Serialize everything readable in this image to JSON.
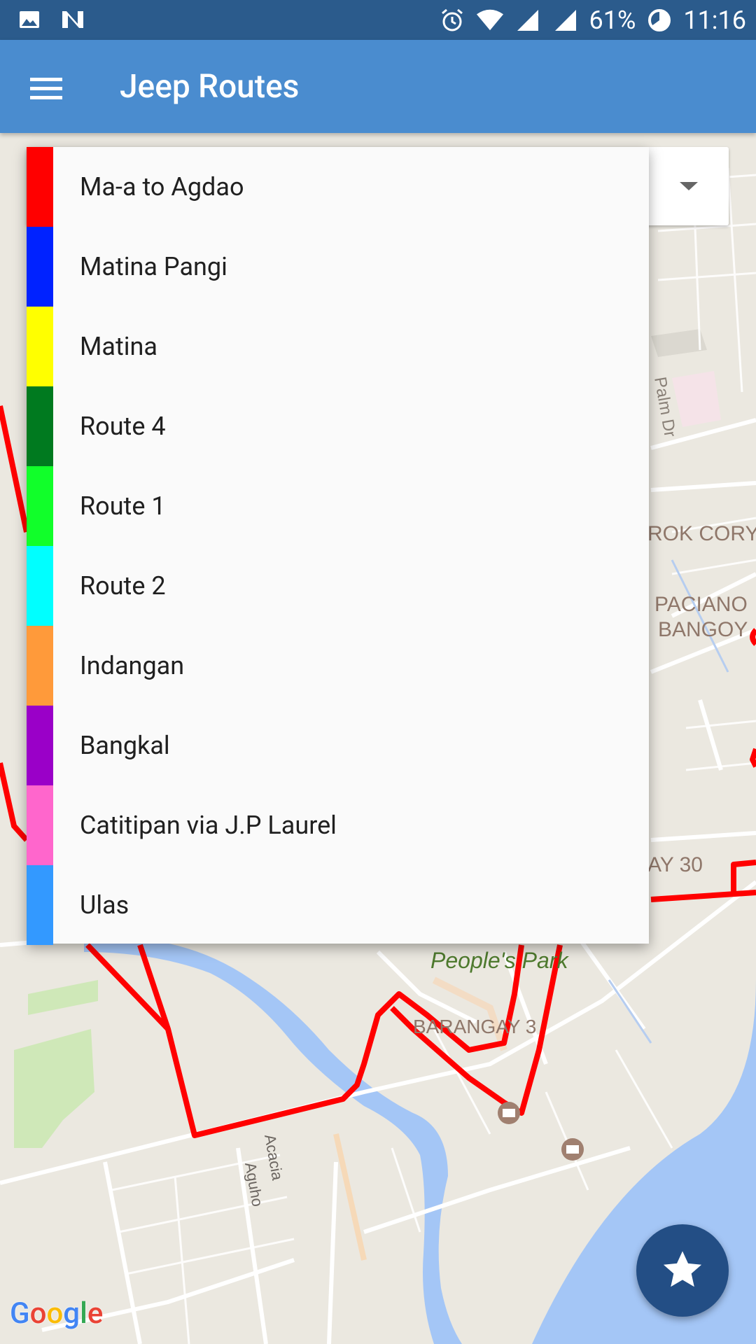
{
  "status_bar": {
    "battery": "61%",
    "time": "11:16",
    "icons": [
      "image-icon",
      "n-icon",
      "alarm-icon",
      "wifi-icon",
      "signal-icon",
      "signal-icon",
      "battery-icon"
    ]
  },
  "app_bar": {
    "title": "Jeep Routes",
    "menu_icon": "hamburger-menu-icon"
  },
  "route_dropdown": {
    "items": [
      {
        "label": "Ma-a to Agdao",
        "color": "#ff0000"
      },
      {
        "label": "Matina Pangi",
        "color": "#0022ff"
      },
      {
        "label": "Matina",
        "color": "#ffff00"
      },
      {
        "label": "Route 4",
        "color": "#007a1f"
      },
      {
        "label": "Route 1",
        "color": "#11ff2a"
      },
      {
        "label": "Route 2",
        "color": "#00ffff"
      },
      {
        "label": "Indangan",
        "color": "#ff9a3a"
      },
      {
        "label": "Bangkal",
        "color": "#9a00c8"
      },
      {
        "label": "Catitipan via J.P Laurel",
        "color": "#ff66cc"
      },
      {
        "label": "Ulas",
        "color": "#3399ff"
      }
    ]
  },
  "map": {
    "labels": {
      "palm_dr": "Palm Dr",
      "prok_cory": "ROK CORY",
      "paciano_bangoy_1": "PACIANO",
      "paciano_bangoy_2": "BANGOY",
      "barangay_30": "AY 30",
      "peoples_park": "People's Park",
      "barangay_3": "BARANGAY 3",
      "acacia": "Acacia",
      "aguho": "Aguho"
    },
    "attribution": "Google",
    "route_color": "#ff0000"
  },
  "fab": {
    "icon": "star-icon"
  }
}
